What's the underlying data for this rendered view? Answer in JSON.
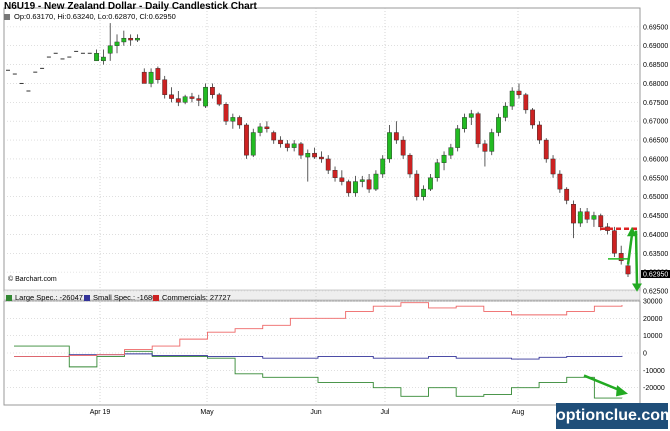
{
  "title": "N6U19 - New Zealand Dollar - Daily Candlestick Chart",
  "ohlc_text": "Op:0.63170, Hi:0.63240, Lo:0.62870, Cl:0.62950",
  "source": "© Barchart.com",
  "last_price_label": "0.62950",
  "logo_text": "optionclue.com",
  "legend": {
    "large": "Large Spec.: -26047",
    "small": "Small Spec.: -1680",
    "comm": "Commercials: 27727"
  },
  "colors": {
    "up": "#22bb22",
    "down": "#cc2222",
    "large": "#338833",
    "small": "#333399",
    "comm": "#ee6666",
    "arrow": "#22aa22",
    "level": "#dd2222"
  },
  "chart_data": [
    {
      "type": "candlestick",
      "title": "N6U19 - New Zealand Dollar - Daily Candlestick Chart",
      "ylim": [
        0.625,
        0.7
      ],
      "y_ticks": [
        "0.69500",
        "0.69000",
        "0.68500",
        "0.68000",
        "0.67500",
        "0.67000",
        "0.66500",
        "0.66000",
        "0.65500",
        "0.65000",
        "0.64500",
        "0.64000",
        "0.63500",
        "0.63000",
        "0.62500"
      ],
      "x_ticks": [
        "Apr 19",
        "May",
        "Jun",
        "Jul",
        "Aug"
      ],
      "annotation": "dashed horizontal line near 0.6415",
      "candles": [
        [
          0.6835,
          0.6835,
          0.6835,
          0.6835
        ],
        [
          0.6825,
          0.6825,
          0.6825,
          0.6825
        ],
        [
          0.68,
          0.68,
          0.68,
          0.68
        ],
        [
          0.678,
          0.678,
          0.678,
          0.678
        ],
        [
          0.683,
          0.683,
          0.683,
          0.683
        ],
        [
          0.684,
          0.684,
          0.684,
          0.684
        ],
        [
          0.687,
          0.687,
          0.687,
          0.687
        ],
        [
          0.688,
          0.688,
          0.688,
          0.688
        ],
        [
          0.6865,
          0.6865,
          0.6865,
          0.6865
        ],
        [
          0.687,
          0.687,
          0.687,
          0.687
        ],
        [
          0.6885,
          0.6885,
          0.6885,
          0.6885
        ],
        [
          0.688,
          0.688,
          0.688,
          0.688
        ],
        [
          0.688,
          0.688,
          0.688,
          0.688
        ],
        [
          0.686,
          0.689,
          0.686,
          0.688
        ],
        [
          0.686,
          0.689,
          0.685,
          0.687
        ],
        [
          0.688,
          0.696,
          0.686,
          0.69
        ],
        [
          0.69,
          0.693,
          0.688,
          0.691
        ],
        [
          0.691,
          0.694,
          0.69,
          0.692
        ],
        [
          0.692,
          0.693,
          0.69,
          0.6915
        ],
        [
          0.6915,
          0.693,
          0.691,
          0.692
        ],
        [
          0.683,
          0.684,
          0.68,
          0.68
        ],
        [
          0.68,
          0.684,
          0.679,
          0.683
        ],
        [
          0.684,
          0.6845,
          0.68,
          0.681
        ],
        [
          0.681,
          0.682,
          0.676,
          0.677
        ],
        [
          0.677,
          0.679,
          0.675,
          0.676
        ],
        [
          0.676,
          0.678,
          0.674,
          0.675
        ],
        [
          0.675,
          0.677,
          0.6745,
          0.6765
        ],
        [
          0.6765,
          0.6775,
          0.675,
          0.676
        ],
        [
          0.676,
          0.677,
          0.674,
          0.6755
        ],
        [
          0.674,
          0.68,
          0.6735,
          0.679
        ],
        [
          0.679,
          0.68,
          0.676,
          0.677
        ],
        [
          0.677,
          0.6775,
          0.674,
          0.6745
        ],
        [
          0.6745,
          0.675,
          0.669,
          0.67
        ],
        [
          0.67,
          0.672,
          0.668,
          0.671
        ],
        [
          0.671,
          0.6715,
          0.668,
          0.669
        ],
        [
          0.669,
          0.6695,
          0.66,
          0.661
        ],
        [
          0.661,
          0.668,
          0.6605,
          0.667
        ],
        [
          0.667,
          0.6695,
          0.666,
          0.6685
        ],
        [
          0.6685,
          0.67,
          0.667,
          0.668
        ],
        [
          0.667,
          0.6675,
          0.664,
          0.665
        ],
        [
          0.665,
          0.666,
          0.663,
          0.664
        ],
        [
          0.664,
          0.665,
          0.662,
          0.663
        ],
        [
          0.663,
          0.665,
          0.662,
          0.664
        ],
        [
          0.664,
          0.6645,
          0.66,
          0.661
        ],
        [
          0.6605,
          0.6625,
          0.654,
          0.6615
        ],
        [
          0.6615,
          0.663,
          0.66,
          0.6605
        ],
        [
          0.6605,
          0.662,
          0.659,
          0.66
        ],
        [
          0.66,
          0.661,
          0.656,
          0.657
        ],
        [
          0.657,
          0.658,
          0.654,
          0.655
        ],
        [
          0.655,
          0.657,
          0.653,
          0.654
        ],
        [
          0.654,
          0.6545,
          0.65,
          0.651
        ],
        [
          0.651,
          0.6555,
          0.65,
          0.654
        ],
        [
          0.654,
          0.6555,
          0.6525,
          0.6545
        ],
        [
          0.6545,
          0.656,
          0.651,
          0.652
        ],
        [
          0.652,
          0.657,
          0.6515,
          0.656
        ],
        [
          0.656,
          0.661,
          0.655,
          0.66
        ],
        [
          0.66,
          0.669,
          0.659,
          0.667
        ],
        [
          0.667,
          0.67,
          0.664,
          0.665
        ],
        [
          0.665,
          0.666,
          0.66,
          0.661
        ],
        [
          0.661,
          0.6615,
          0.655,
          0.656
        ],
        [
          0.656,
          0.657,
          0.649,
          0.65
        ],
        [
          0.65,
          0.653,
          0.649,
          0.652
        ],
        [
          0.652,
          0.656,
          0.6515,
          0.655
        ],
        [
          0.655,
          0.66,
          0.654,
          0.659
        ],
        [
          0.659,
          0.662,
          0.657,
          0.661
        ],
        [
          0.661,
          0.664,
          0.66,
          0.663
        ],
        [
          0.663,
          0.669,
          0.662,
          0.668
        ],
        [
          0.668,
          0.672,
          0.667,
          0.671
        ],
        [
          0.671,
          0.673,
          0.669,
          0.672
        ],
        [
          0.672,
          0.6725,
          0.663,
          0.664
        ],
        [
          0.664,
          0.665,
          0.658,
          0.662
        ],
        [
          0.662,
          0.668,
          0.661,
          0.667
        ],
        [
          0.667,
          0.672,
          0.666,
          0.671
        ],
        [
          0.671,
          0.675,
          0.67,
          0.674
        ],
        [
          0.674,
          0.679,
          0.673,
          0.678
        ],
        [
          0.678,
          0.68,
          0.676,
          0.677
        ],
        [
          0.677,
          0.6775,
          0.672,
          0.673
        ],
        [
          0.673,
          0.6735,
          0.668,
          0.669
        ],
        [
          0.669,
          0.67,
          0.664,
          0.665
        ],
        [
          0.665,
          0.6655,
          0.659,
          0.66
        ],
        [
          0.66,
          0.661,
          0.655,
          0.656
        ],
        [
          0.656,
          0.657,
          0.651,
          0.652
        ],
        [
          0.652,
          0.6525,
          0.648,
          0.649
        ],
        [
          0.648,
          0.649,
          0.639,
          0.643
        ],
        [
          0.643,
          0.647,
          0.642,
          0.646
        ],
        [
          0.646,
          0.647,
          0.643,
          0.644
        ],
        [
          0.644,
          0.646,
          0.642,
          0.645
        ],
        [
          0.645,
          0.6455,
          0.641,
          0.642
        ],
        [
          0.642,
          0.643,
          0.64,
          0.641
        ],
        [
          0.641,
          0.642,
          0.634,
          0.635
        ],
        [
          0.635,
          0.637,
          0.632,
          0.633
        ],
        [
          0.6317,
          0.6324,
          0.6287,
          0.6295
        ]
      ]
    },
    {
      "type": "step-line",
      "title": "Commitment of Traders",
      "ylim": [
        -30000,
        30000
      ],
      "y_ticks": [
        "30000",
        "20000",
        "10000",
        "0",
        "-10000",
        "-20000"
      ],
      "series": [
        {
          "name": "Large Spec.: -26047",
          "values": [
            4000,
            4000,
            -8000,
            -2000,
            1000,
            -2000,
            -2000,
            -3000,
            -12000,
            -14000,
            -14000,
            -17000,
            -17000,
            -20000,
            -25000,
            -20000,
            -25000,
            -24000,
            -20000,
            -17000,
            -14000,
            -26000,
            -26047
          ]
        },
        {
          "name": "Small Spec.: -1680",
          "values": [
            -2000,
            -2000,
            -1000,
            -1000,
            -500,
            -1500,
            -1500,
            -2000,
            -2000,
            -3000,
            -3000,
            -2000,
            -2000,
            -3000,
            -3000,
            -2000,
            -3000,
            -3000,
            -3500,
            -2500,
            -2000,
            -2000,
            -1680
          ]
        },
        {
          "name": "Commercials: 27727",
          "values": [
            -2000,
            -2000,
            -1500,
            -1000,
            2000,
            4000,
            8000,
            12000,
            14000,
            16000,
            20000,
            20000,
            24000,
            27000,
            29000,
            26000,
            27000,
            24000,
            22000,
            22000,
            24000,
            27000,
            27727
          ]
        }
      ]
    }
  ]
}
